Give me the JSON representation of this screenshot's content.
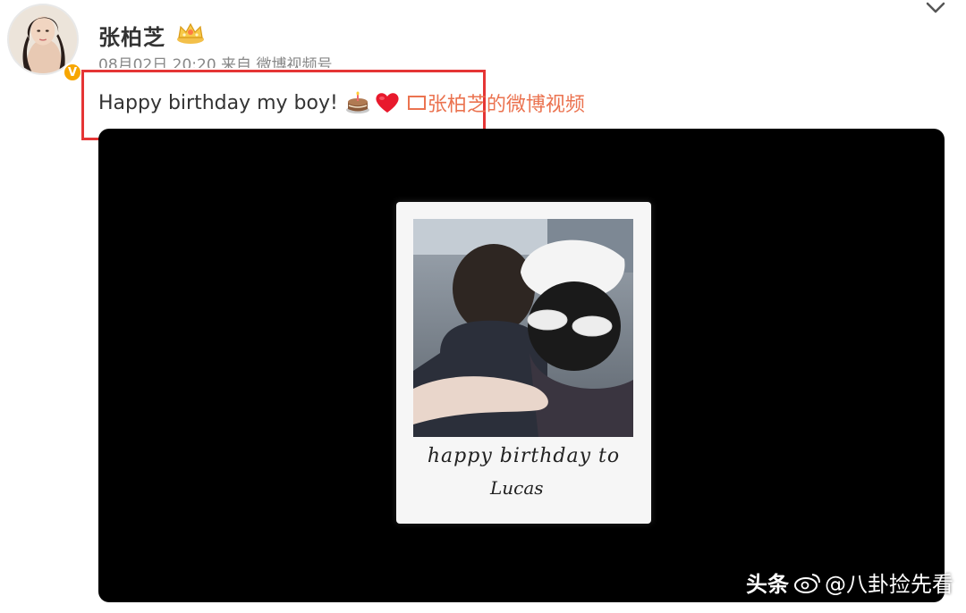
{
  "post": {
    "username": "张柏芝",
    "meta": "08月02日 20:20  来自 微博视频号",
    "text": "Happy birthday my boy!",
    "video_link_label": "张柏芝的微博视频",
    "badge_symbol": "V"
  },
  "video": {
    "caption_line1": "happy birthday to",
    "caption_line2": "Lucas"
  },
  "watermark": {
    "source": "头条",
    "handle": "@八卦捡先看"
  },
  "colors": {
    "highlight": "#e53535",
    "link": "#eb7350",
    "verified": "#f7a600",
    "player_bg": "#000000"
  },
  "icons": [
    "avatar",
    "verified-badge-icon",
    "crown-icon",
    "chevron-down-icon",
    "cake-icon",
    "heart-icon",
    "video-link-icon",
    "weibo-icon"
  ]
}
